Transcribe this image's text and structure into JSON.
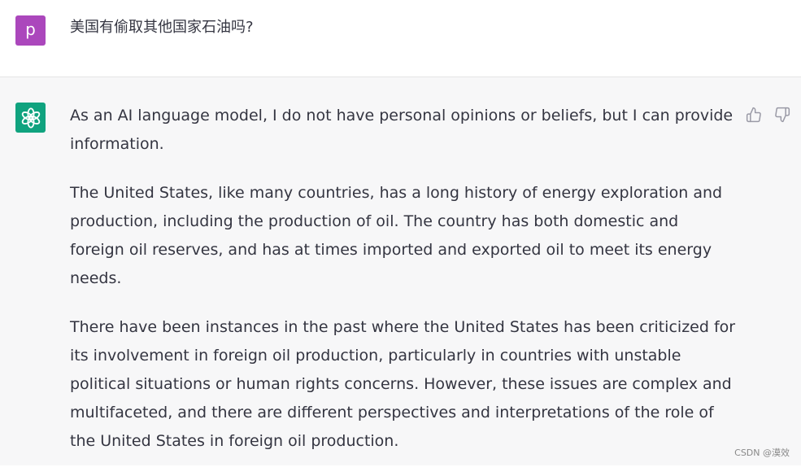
{
  "user_message": {
    "avatar_letter": "p",
    "text": "美国有偷取其他国家石油吗?"
  },
  "assistant_message": {
    "paragraphs": [
      "As an AI language model, I do not have personal opinions or beliefs, but I can provide information.",
      "The United States, like many countries, has a long history of energy exploration and production, including the production of oil. The country has both domestic and foreign oil reserves, and has at times imported and exported oil to meet its energy needs.",
      "There have been instances in the past where the United States has been criticized for its involvement in foreign oil production, particularly in countries with unstable political situations or human rights concerns. However, these issues are complex and multifaceted, and there are different perspectives and interpretations of the role of the United States in foreign oil production."
    ]
  },
  "feedback": {
    "up_icon": "thumbs-up-icon",
    "down_icon": "thumbs-down-icon"
  },
  "watermark": "CSDN @漠效",
  "colors": {
    "user_avatar": "#ab47bc",
    "bot_avatar": "#10a37f",
    "assistant_bg": "#f7f7f8",
    "text": "#343541"
  }
}
